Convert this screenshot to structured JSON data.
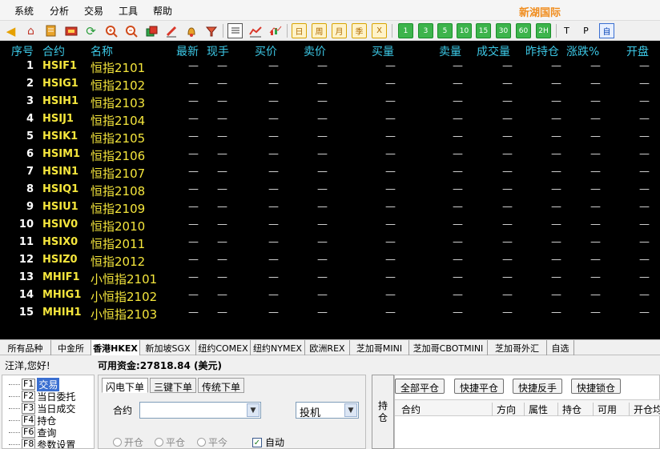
{
  "menu": {
    "items": [
      "系统",
      "分析",
      "交易",
      "工具",
      "帮助"
    ],
    "brand": "新湖国际"
  },
  "toolbar": {
    "period_buttons": [
      "日",
      "周",
      "月",
      "季",
      "X"
    ],
    "minute_buttons": [
      "1",
      "3",
      "5",
      "10",
      "15",
      "30",
      "60",
      "2H"
    ],
    "text_buttons": [
      "T",
      "P",
      "自"
    ]
  },
  "quote": {
    "headers": [
      "序号",
      "合约",
      "名称",
      "最新",
      "现手",
      "买价",
      "卖价",
      "买量",
      "卖量",
      "成交量",
      "昨持仓",
      "涨跌%",
      "开盘"
    ],
    "empty_value": "—",
    "rows": [
      {
        "seq": "1",
        "code": "HSIF1",
        "name": "恒指2101"
      },
      {
        "seq": "2",
        "code": "HSIG1",
        "name": "恒指2102"
      },
      {
        "seq": "3",
        "code": "HSIH1",
        "name": "恒指2103"
      },
      {
        "seq": "4",
        "code": "HSIJ1",
        "name": "恒指2104"
      },
      {
        "seq": "5",
        "code": "HSIK1",
        "name": "恒指2105"
      },
      {
        "seq": "6",
        "code": "HSIM1",
        "name": "恒指2106"
      },
      {
        "seq": "7",
        "code": "HSIN1",
        "name": "恒指2107"
      },
      {
        "seq": "8",
        "code": "HSIQ1",
        "name": "恒指2108"
      },
      {
        "seq": "9",
        "code": "HSIU1",
        "name": "恒指2109"
      },
      {
        "seq": "10",
        "code": "HSIV0",
        "name": "恒指2010"
      },
      {
        "seq": "11",
        "code": "HSIX0",
        "name": "恒指2011"
      },
      {
        "seq": "12",
        "code": "HSIZ0",
        "name": "恒指2012"
      },
      {
        "seq": "13",
        "code": "MHIF1",
        "name": "小恒指2101"
      },
      {
        "seq": "14",
        "code": "MHIG1",
        "name": "小恒指2102"
      },
      {
        "seq": "15",
        "code": "MHIH1",
        "name": "小恒指2103"
      }
    ]
  },
  "market_tabs": [
    "所有品种",
    "中金所",
    "香港HKEX",
    "新加坡SGX",
    "纽约COMEX",
    "纽约NYMEX",
    "欧洲REX",
    "芝加哥MINI",
    "芝加哥CBOTMINI",
    "芝加哥外汇",
    "自选"
  ],
  "market_tab_active": "香港HKEX",
  "account": {
    "greeting": "汪洋,您好!",
    "funds_label": "可用资金:27818.84 (美元)"
  },
  "nav": [
    {
      "key": "F1",
      "label": "交易",
      "active": true
    },
    {
      "key": "F2",
      "label": "当日委托"
    },
    {
      "key": "F3",
      "label": "当日成交"
    },
    {
      "key": "F4",
      "label": "持仓"
    },
    {
      "key": "F6",
      "label": "查询"
    },
    {
      "key": "F8",
      "label": "参数设置"
    }
  ],
  "order": {
    "tabs": [
      "闪电下单",
      "三键下单",
      "传统下单"
    ],
    "contract_label": "合约",
    "contract_value": "",
    "speculation": "投机",
    "radios": [
      "开仓",
      "平仓",
      "平今"
    ],
    "auto_label": "自动",
    "auto_checked": true
  },
  "position": {
    "side_tab": "持仓",
    "buttons": [
      "全部平仓",
      "快捷平仓",
      "快捷反手",
      "快捷锁仓"
    ],
    "headers": [
      "合约",
      "方向",
      "属性",
      "持仓",
      "可用",
      "开仓均"
    ]
  }
}
